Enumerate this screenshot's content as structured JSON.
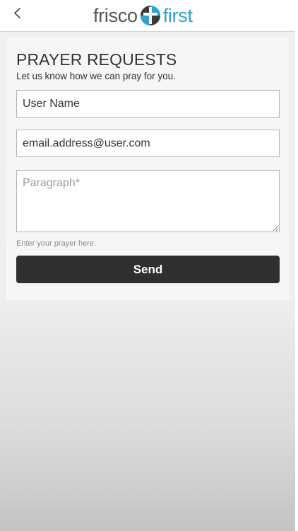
{
  "header": {
    "logo_word1": "frisco",
    "logo_word2": "first",
    "back_icon": "chevron-left-icon",
    "logo_mark_icon": "cross-circle-icon"
  },
  "form": {
    "title": "PRAYER REQUESTS",
    "subtitle": "Let us know how we can pray for you.",
    "name_value": "User Name",
    "email_value": "email.address@user.com",
    "paragraph_placeholder": "Paragraph*",
    "paragraph_value": "",
    "hint": "Enter your prayer here.",
    "send_label": "Send"
  },
  "colors": {
    "brand_blue": "#2aa2d8",
    "brand_grey": "#555555",
    "button_dark": "#2f2f2f"
  }
}
